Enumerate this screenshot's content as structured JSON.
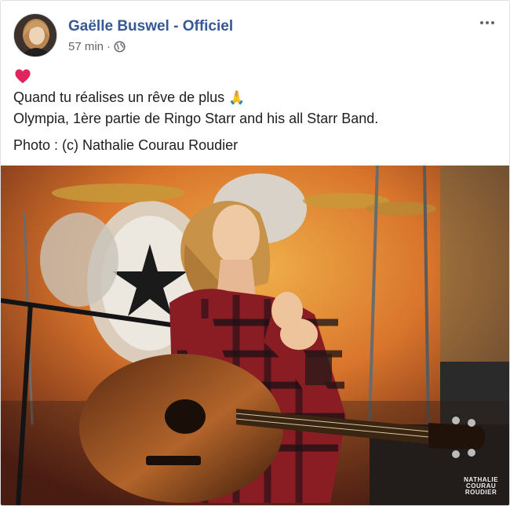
{
  "post": {
    "author": "Gaëlle Buswel - Officiel",
    "timestamp": "57 min",
    "separator": "·",
    "privacy_icon": "globe-icon",
    "more_icon": "more-options-icon",
    "reaction_emoji": "heart-emoji",
    "lines": [
      "Quand tu réalises un rêve de plus",
      "Olympia, 1ère partie de Ringo Starr and his all Starr Band."
    ],
    "line1_emoji": "🙏",
    "credit": "Photo : (c) Nathalie Courau Roudier"
  },
  "photo": {
    "watermark": [
      "NATHALIE",
      "COURAU",
      "ROUDIER"
    ]
  },
  "colors": {
    "author": "#365899",
    "meta": "#616770",
    "heart": "#e0245e"
  }
}
